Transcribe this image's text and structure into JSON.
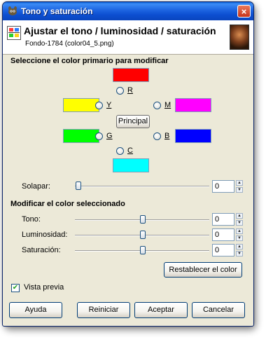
{
  "window": {
    "title": "Tono y saturación",
    "close": "×"
  },
  "header": {
    "title": "Ajustar el tono / luminosidad / saturación",
    "subtitle": "Fondo-1784 (color04_5.png)"
  },
  "primary_section": {
    "title": "Seleccione el color primario para modificar",
    "colors": {
      "R": {
        "label": "R",
        "color": "#ff0000"
      },
      "Y": {
        "label": "Y",
        "color": "#ffff00"
      },
      "M": {
        "label": "M",
        "color": "#ff00ff"
      },
      "G": {
        "label": "G",
        "color": "#00ff00"
      },
      "B": {
        "label": "B",
        "color": "#0000ff"
      },
      "C": {
        "label": "C",
        "color": "#00ffff"
      }
    },
    "principal_label": "Principal"
  },
  "overlap": {
    "label": "Solapar:",
    "value": "0",
    "level_fraction": 0
  },
  "modify_section": {
    "title": "Modificar el color seleccionado",
    "tone": {
      "label": "Tono:",
      "value": "0",
      "level_fraction": 0.5
    },
    "lightness": {
      "label": "Luminosidad:",
      "value": "0",
      "level_fraction": 0.5
    },
    "saturation": {
      "label": "Saturación:",
      "value": "0",
      "level_fraction": 0.5
    },
    "reset_color_label": "Restablecer el color"
  },
  "preview": {
    "label": "Vista previa",
    "checked": true
  },
  "buttons": {
    "help": "Ayuda",
    "reset": "Reiniciar",
    "accept": "Aceptar",
    "cancel": "Cancelar"
  }
}
